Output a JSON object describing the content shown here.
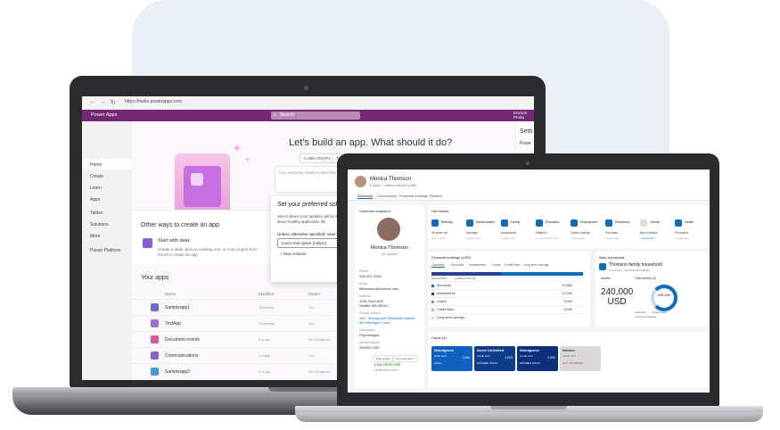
{
  "browser": {
    "url": "https://make.powerapps.com"
  },
  "powerapps": {
    "app_name": "Power Apps",
    "search_placeholder": "Search",
    "environment": "Environ\nProdu",
    "nav": [
      "Home",
      "Create",
      "Learn",
      "Apps",
      "Tables",
      "Solutions",
      "More",
      "Power Platform"
    ],
    "hero_title": "Let’s build an app. What should it do?",
    "chips": [
      "Collect RSVPs",
      "Trac"
    ],
    "prompt_placeholder": "Use everyday words to describe what",
    "other_ways_title": "Other ways to create an app",
    "start_with_data_title": "Start with data",
    "start_with_data_desc": "Create a table, pick an existing one, or even import from Excel to create an app",
    "your_apps_title": "Your apps",
    "apps_columns": [
      "Name",
      "Modified",
      "Owner"
    ],
    "apps": [
      {
        "name": "Sampleapp1",
        "modified": "Yesterday",
        "owner": "You",
        "color": "#6b69d6"
      },
      {
        "name": "TestApp",
        "modified": "Yesterday",
        "owner": "You",
        "color": "#a06ad8"
      },
      {
        "name": "Document events",
        "modified": "3 d ago",
        "owner": "Nir Feinapuch",
        "color": "#d85a9a"
      },
      {
        "name": "Communications",
        "modified": "3 d ago",
        "owner": "You",
        "color": "#8a5fd8"
      },
      {
        "name": "Sampleapp2",
        "modified": "3 d ago",
        "owner": "Nir Feinapuch",
        "color": "#3f9ad8"
      }
    ],
    "popup": {
      "title": "Set your preferred solutio",
      "desc": "Select where your updates will be saved u... Learn more about healthy application life",
      "label": "Unless otherwise specified, save my",
      "selected": "Jose’s test space (mdyrn)",
      "new_solution": "New solution"
    },
    "settings_title": "Setti",
    "settings_item": "Powe"
  },
  "crm": {
    "contact_name": "Monica Thomson",
    "contact_sub": "Contact · Unified customer profile",
    "tabs": [
      "Summary",
      "Connections",
      "Financial holdings",
      "Related"
    ],
    "snapshot": {
      "title": "Customer snapshot",
      "name": "Monica Thomson",
      "status": "ID, Married",
      "fields": [
        {
          "label": "Phone",
          "value": "206-307-3344",
          "link": false
        },
        {
          "label": "Email",
          "value": "Mthomson@outlook.com",
          "link": false
        },
        {
          "label": "Address",
          "value": "1108 22nd AVE\nSeattle WA 98144",
          "link": false
        },
        {
          "label": "Primary branch",
          "value": "115 - Woodgrove Savannah branch\n55d Michigan Court",
          "link": true
        },
        {
          "label": "Occupation",
          "value": "Psychologist",
          "link": false
        },
        {
          "label": "Annual income",
          "value": "240000 USD",
          "link": false
        }
      ],
      "tags": [
        "High wealth",
        "Non tech-savvy"
      ],
      "risk": "Low churn risk",
      "risk_desc": "Likelihood to churn"
    },
    "life_events": {
      "title": "Life events",
      "items": [
        {
          "title": "Birthday",
          "value": "46 years old",
          "sub": "Jan 7, 2023"
        },
        {
          "title": "Marital status",
          "value": "Marriage",
          "sub": "4 years ago"
        },
        {
          "title": "Family",
          "value": "Anniversary",
          "sub": "3 years ago"
        },
        {
          "title": "Education",
          "value": "Master's",
          "sub": "6 months from now"
        },
        {
          "title": "Employment",
          "value": "Career change",
          "sub": "2 years ago"
        },
        {
          "title": "Residence",
          "value": "Purchase",
          "sub": "4 years ago"
        },
        {
          "title": "Vehicle",
          "value": "Buy a vehicle",
          "sub": "+ Add event"
        },
        {
          "title": "Health",
          "value": "Procedure",
          "sub": "4 years ago"
        }
      ]
    },
    "financial": {
      "title": "Financial holdings (USD)",
      "tabs": [
        "Overview",
        "Accounts",
        "Investments",
        "Loans",
        "Credit lines",
        "Long term savings"
      ],
      "rows": [
        {
          "key": "Accounts",
          "value": "23,660",
          "color": "#0f6cbd"
        },
        {
          "key": "Investments",
          "value": "12,000",
          "color": "#2c3e8f"
        },
        {
          "key": "Loans",
          "value": "9,000",
          "color": "#5aa2de"
        },
        {
          "key": "Credit lines",
          "value": "5,000",
          "color": "#8cc2ef"
        },
        {
          "key": "Long term savings",
          "value": "",
          "color": "#c1ddf5"
        }
      ],
      "assets_label": "Assets $45%",
      "liab_label": "Liabilities 55% ($)"
    },
    "household": {
      "title": "Main household",
      "name": "Thomson family household",
      "desc": "4 members · 2% financial holdings",
      "assets_label": "Assets",
      "amount": "240,000\nUSD",
      "total_label": "Total assets (4)",
      "ring_value": "305,532",
      "legend": [
        "Accounts",
        "Investments",
        "Long term savings"
      ]
    },
    "cards": {
      "title": "Cards (4)",
      "items": [
        {
          "brand": "Woodgrove",
          "sub": "Debit card",
          "num": "1,094",
          "status": "Active",
          "color": "#1060c0"
        },
        {
          "brand": "Acme Unlimited",
          "sub": "Credit card",
          "num": "4,003",
          "status": "EXPIRED SOON",
          "color": "#0f3c8a"
        },
        {
          "brand": "Woodgrove",
          "sub": "Credit card",
          "num": "2,990",
          "status": "EXPIRES SOON",
          "color": "#0b2f7a"
        },
        {
          "brand": "Novaro",
          "sub": "Credit card",
          "num": "",
          "status": "NOT ACTIVATED",
          "color": "#d9d9d9"
        }
      ]
    }
  }
}
